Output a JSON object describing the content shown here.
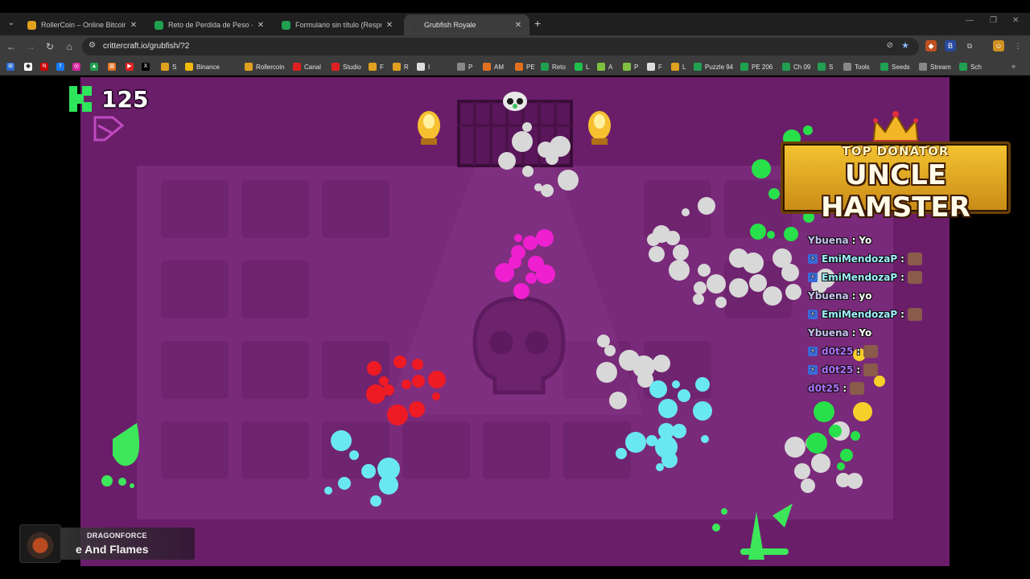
{
  "browser": {
    "tabs": [
      {
        "title": "RollerCoin – Online Bitcoin Mini",
        "favicon_color": "#e0a020",
        "active": false
      },
      {
        "title": "Reto de Perdida de Peso - El M",
        "favicon_color": "#20a050",
        "active": false
      },
      {
        "title": "Formulario sin título (Respuesta",
        "favicon_color": "#20a050",
        "active": false
      },
      {
        "title": "Grubfish Royale",
        "favicon_color": "#3a3a3a",
        "active": true
      }
    ],
    "url": "crittercraft.io/grubfish/?2",
    "bookmarks": [
      {
        "label": "S",
        "color": "#e0a020"
      },
      {
        "label": "Binance",
        "color": "#f0b90b"
      },
      {
        "label": "Rollercoin",
        "color": "#e0a020"
      },
      {
        "label": "Canal",
        "color": "#e02020"
      },
      {
        "label": "Studio",
        "color": "#e02020"
      },
      {
        "label": "F",
        "color": "#e0a020"
      },
      {
        "label": "R",
        "color": "#e0a020"
      },
      {
        "label": "I",
        "color": "#dddddd"
      },
      {
        "label": "P",
        "color": "#888888"
      },
      {
        "label": "AM",
        "color": "#e07020"
      },
      {
        "label": "PE",
        "color": "#e07020"
      },
      {
        "label": "Reto",
        "color": "#20a050"
      },
      {
        "label": "L",
        "color": "#20c050"
      },
      {
        "label": "A",
        "color": "#80c040"
      },
      {
        "label": "P",
        "color": "#80c040"
      },
      {
        "label": "F",
        "color": "#dddddd"
      },
      {
        "label": "L",
        "color": "#e0a020"
      },
      {
        "label": "Puzzle 94",
        "color": "#20a050"
      },
      {
        "label": "PE 206",
        "color": "#20a050"
      },
      {
        "label": "Ch 09",
        "color": "#20a050"
      },
      {
        "label": "S",
        "color": "#20a050"
      },
      {
        "label": "Tools",
        "color": "#888888"
      },
      {
        "label": "Seeds",
        "color": "#20a050"
      },
      {
        "label": "Stream",
        "color": "#888888"
      },
      {
        "label": "Sch",
        "color": "#20a050"
      }
    ]
  },
  "game": {
    "score": "125",
    "banner": {
      "top": "TOP DONATOR",
      "name": "UNCLE HAMSTER"
    },
    "chat": [
      {
        "user": "Ybuena",
        "msg": "Yo",
        "color": "#c9c2f2",
        "badge": false,
        "emote": false
      },
      {
        "user": "EmiMendozaP",
        "msg": "",
        "color": "#9ff0ff",
        "badge": true,
        "emote": true
      },
      {
        "user": "EmiMendozaP",
        "msg": "",
        "color": "#9ff0ff",
        "badge": true,
        "emote": true
      },
      {
        "user": "Ybuena",
        "msg": "yo",
        "color": "#c9c2f2",
        "badge": false,
        "emote": false
      },
      {
        "user": "EmiMendozaP",
        "msg": "",
        "color": "#9ff0ff",
        "badge": true,
        "emote": true
      },
      {
        "user": "Ybuena",
        "msg": "Yo",
        "color": "#c9c2f2",
        "badge": false,
        "emote": false
      },
      {
        "user": "d0t25",
        "msg": "",
        "color": "#b070ff",
        "badge": true,
        "emote": true
      },
      {
        "user": "d0t25",
        "msg": "",
        "color": "#b070ff",
        "badge": true,
        "emote": true
      },
      {
        "user": "d0t25",
        "msg": "",
        "color": "#b070ff",
        "badge": false,
        "emote": true
      }
    ],
    "now_playing": {
      "artist": "DRAGONFORCE",
      "track": "e And Flames"
    }
  }
}
